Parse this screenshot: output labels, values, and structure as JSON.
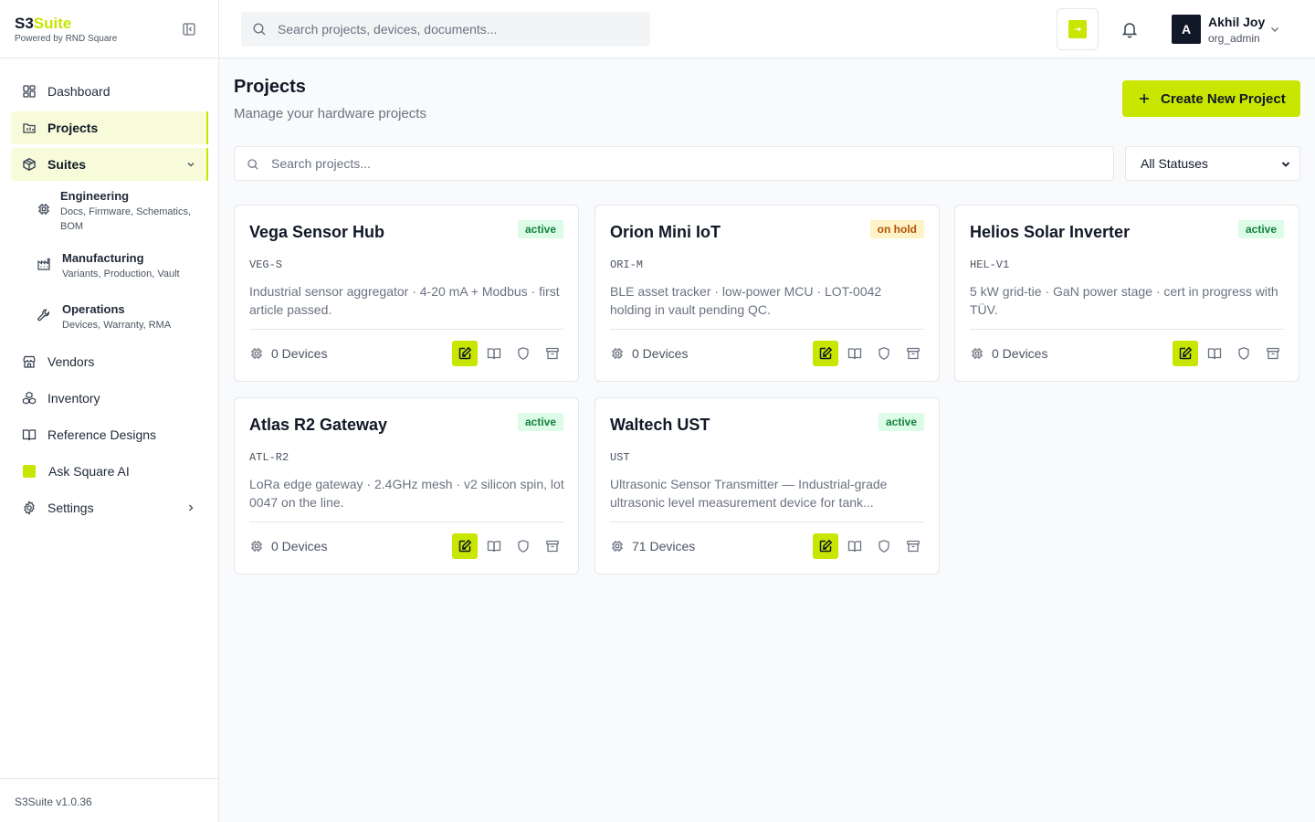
{
  "brand": {
    "name_part1": "S3",
    "name_part2": "Suite",
    "tagline": "Powered by RND Square"
  },
  "sidebar": {
    "items": [
      {
        "label": "Dashboard",
        "icon": "dashboard-icon"
      },
      {
        "label": "Projects",
        "icon": "projects-icon",
        "active": true
      },
      {
        "label": "Suites",
        "icon": "box-icon",
        "active": true,
        "expanded": true
      }
    ],
    "suites": [
      {
        "title": "Engineering",
        "desc": "Docs, Firmware, Schematics, BOM",
        "icon": "chip-icon"
      },
      {
        "title": "Manufacturing",
        "desc": "Variants, Production, Vault",
        "icon": "factory-icon"
      },
      {
        "title": "Operations",
        "desc": "Devices, Warranty, RMA",
        "icon": "wrench-icon"
      }
    ],
    "items_after": [
      {
        "label": "Vendors",
        "icon": "store-icon"
      },
      {
        "label": "Inventory",
        "icon": "boxes-icon"
      },
      {
        "label": "Reference Designs",
        "icon": "book-icon"
      },
      {
        "label": "Ask Square AI",
        "icon": "ai-square-icon"
      },
      {
        "label": "Settings",
        "icon": "gear-icon"
      }
    ],
    "version": "S3Suite v1.0.36"
  },
  "header": {
    "search_placeholder": "Search projects, devices, documents...",
    "user": {
      "initial": "A",
      "name": "Akhil Joy",
      "role": "org_admin"
    }
  },
  "main": {
    "title": "Projects",
    "subtitle": "Manage your hardware projects",
    "create_label": "Create New Project",
    "search_placeholder": "Search projects...",
    "status_filter": "All Statuses"
  },
  "projects": [
    {
      "name": "Vega Sensor Hub",
      "code": "VEG-S",
      "status": "active",
      "desc": "Industrial sensor aggregator · 4-20 mA + Modbus · first article passed.",
      "devices": "0 Devices"
    },
    {
      "name": "Orion Mini IoT",
      "code": "ORI-M",
      "status": "on hold",
      "desc": "BLE asset tracker · low-power MCU · LOT-0042 holding in vault pending QC.",
      "devices": "0 Devices"
    },
    {
      "name": "Helios Solar Inverter",
      "code": "HEL-V1",
      "status": "active",
      "desc": "5 kW grid-tie · GaN power stage · cert in progress with TÜV.",
      "devices": "0 Devices"
    },
    {
      "name": "Atlas R2 Gateway",
      "code": "ATL-R2",
      "status": "active",
      "desc": "LoRa edge gateway · 2.4GHz mesh · v2 silicon spin, lot 0047 on the line.",
      "devices": "0 Devices"
    },
    {
      "name": "Waltech UST",
      "code": "UST",
      "status": "active",
      "desc": "Ultrasonic Sensor Transmitter — Industrial-grade ultrasonic level measurement device for tank...",
      "devices": "71 Devices"
    }
  ],
  "colors": {
    "accent": "#c8e600",
    "active_badge_bg": "#dcfce7",
    "active_badge_fg": "#15803d",
    "hold_badge_bg": "#fef3c7",
    "hold_badge_fg": "#b45309"
  }
}
